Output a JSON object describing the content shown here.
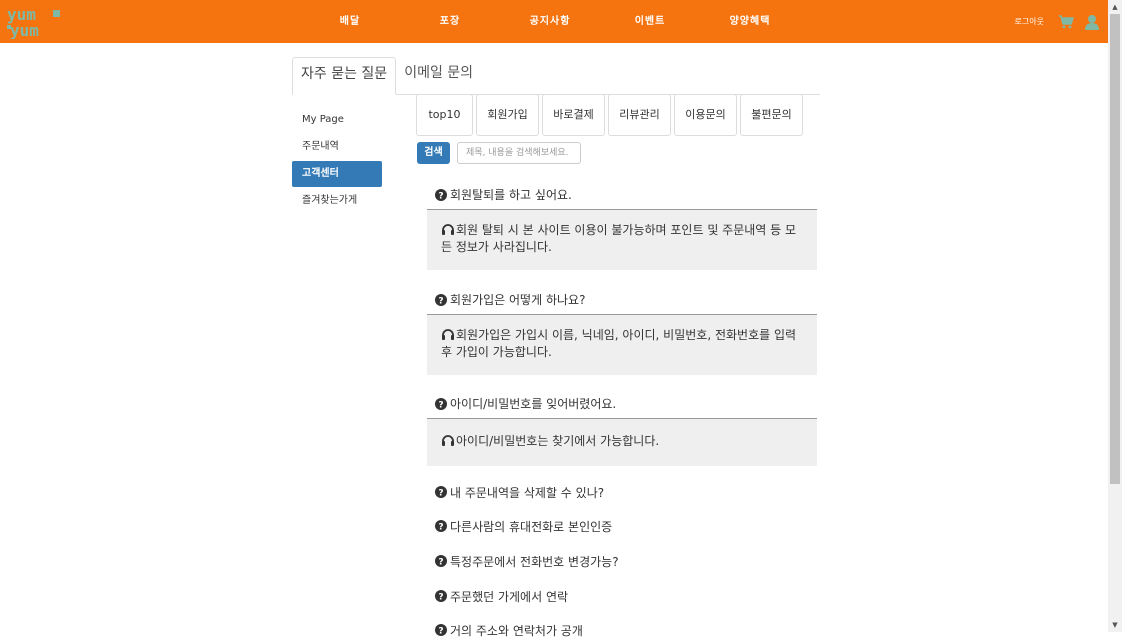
{
  "brand": {
    "logo_alt": "yum yum",
    "accent": "#f5740f",
    "logo_color": "#7fb8a4"
  },
  "nav": {
    "items": [
      "배달",
      "포장",
      "공지사항",
      "이벤트",
      "양양혜택"
    ],
    "logout": "로그아웃",
    "cart_icon": "cart-icon",
    "user_icon": "user-icon"
  },
  "tabs": {
    "faq": "자주 묻는 질문",
    "email": "이메일 문의"
  },
  "sidebar": {
    "items": [
      "My Page",
      "주문내역",
      "고객센터",
      "즐겨찾는가게"
    ],
    "active_index": 2
  },
  "categories": [
    "top10",
    "회원가입",
    "바로결제",
    "리뷰관리",
    "이용문의",
    "불편문의"
  ],
  "search": {
    "button": "검색",
    "placeholder": "제목, 내용을 검색해보세요."
  },
  "faqs": [
    {
      "question": "회원탈퇴를 하고 싶어요.",
      "answer": "회원 탈퇴 시 본 사이트 이용이 불가능하며 포인트 및 주문내역 등 모든 정보가 사라집니다."
    },
    {
      "question": "회원가입은 어떻게 하나요?",
      "answer": "회원가입은 가입시 이름, 닉네임, 아이디, 비밀번호, 전화번호를 입력 후 가입이 가능합니다."
    },
    {
      "question": "아이디/비밀번호를 잊어버렸어요.",
      "answer": "아이디/비밀번호는 찾기에서 가능합니다."
    },
    {
      "question": "내 주문내역을 삭제할 수 있나?",
      "answer": ""
    },
    {
      "question": "다른사람의 휴대전화로 본인인증",
      "answer": ""
    },
    {
      "question": "특정주문에서 전화번호 변경가능?",
      "answer": ""
    },
    {
      "question": "주문했던 가게에서 연락",
      "answer": ""
    },
    {
      "question": "거의 주소와 연락처가 공개",
      "answer": ""
    }
  ]
}
